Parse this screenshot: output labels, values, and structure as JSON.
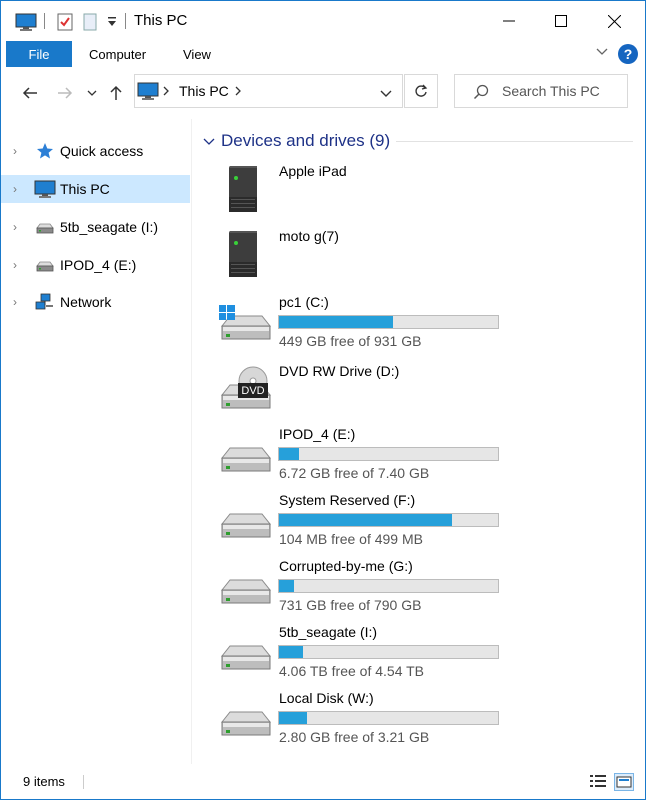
{
  "window": {
    "title": "This PC"
  },
  "ribbon": {
    "file": "File",
    "computer": "Computer",
    "view": "View",
    "help": "?"
  },
  "nav": {
    "address_label": "This PC",
    "search_placeholder": "Search This PC"
  },
  "sidebar": {
    "items": [
      {
        "label": "Quick access"
      },
      {
        "label": "This PC"
      },
      {
        "label": "5tb_seagate (I:)"
      },
      {
        "label": "IPOD_4 (E:)"
      },
      {
        "label": "Network"
      }
    ]
  },
  "content": {
    "group_title": "Devices and drives (9)",
    "devices": [
      {
        "name": "Apple iPad",
        "icon": "portable-device-icon"
      },
      {
        "name": "moto g(7)",
        "icon": "portable-device-icon"
      },
      {
        "name": "pc1 (C:)",
        "free": "449 GB free of 931 GB",
        "used_fraction": 0.52,
        "icon": "windows-drive-icon"
      },
      {
        "name": "DVD RW Drive (D:)",
        "icon": "dvd-drive-icon",
        "icon_label": "DVD"
      },
      {
        "name": "IPOD_4 (E:)",
        "free": "6.72 GB free of 7.40 GB",
        "used_fraction": 0.09,
        "icon": "hard-drive-icon"
      },
      {
        "name": "System Reserved (F:)",
        "free": "104 MB free of 499 MB",
        "used_fraction": 0.79,
        "icon": "hard-drive-icon"
      },
      {
        "name": "Corrupted-by-me (G:)",
        "free": "731 GB free of 790 GB",
        "used_fraction": 0.07,
        "icon": "hard-drive-icon"
      },
      {
        "name": "5tb_seagate (I:)",
        "free": "4.06 TB free of 4.54 TB",
        "used_fraction": 0.11,
        "icon": "hard-drive-icon"
      },
      {
        "name": "Local Disk (W:)",
        "free": "2.80 GB free of 3.21 GB",
        "used_fraction": 0.13,
        "icon": "hard-drive-icon"
      }
    ]
  },
  "status": {
    "count": "9 items"
  },
  "colors": {
    "accent": "#1979ca",
    "bar_fill": "#26a0da",
    "selected": "#cce8ff",
    "group_title": "#1e3287"
  }
}
